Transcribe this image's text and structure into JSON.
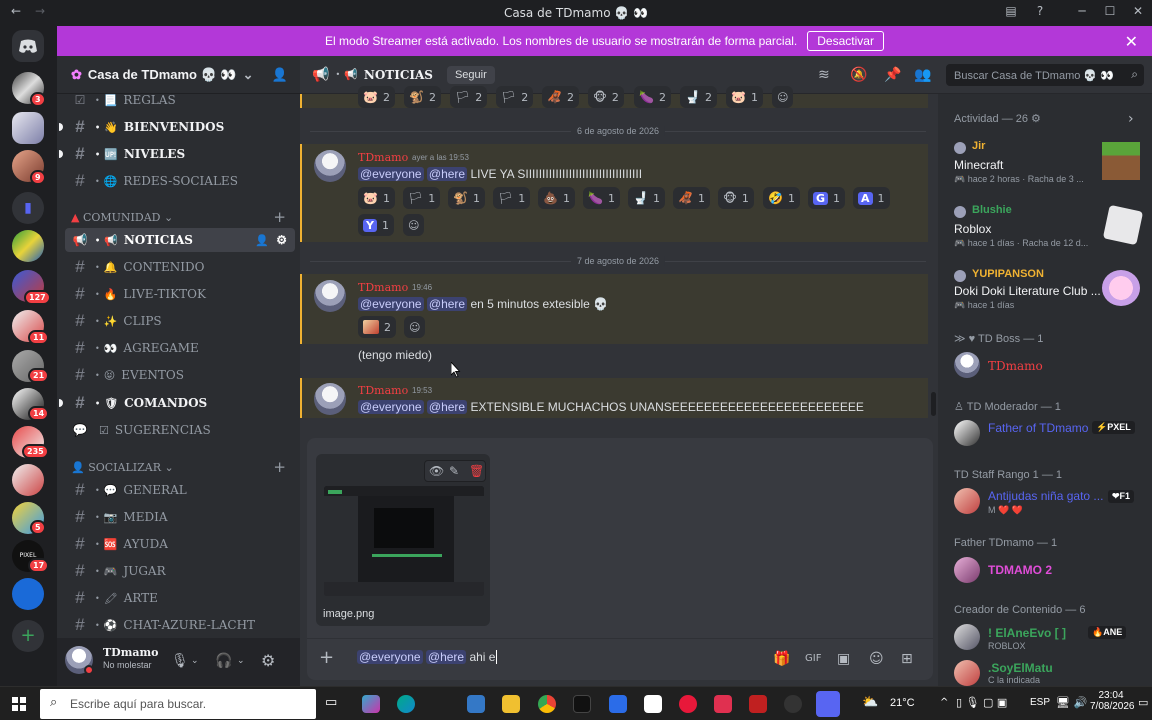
{
  "window": {
    "title": "Casa de TDmamo 💀 👀"
  },
  "banner": {
    "message": "El modo Streamer está activado. Los nombres de usuario se mostrarán de forma parcial.",
    "button": "Desactivar"
  },
  "server_badges": [
    "3",
    "9",
    "127",
    "11",
    "21",
    "14",
    "235",
    "5",
    "17"
  ],
  "server": {
    "name": "Casa de TDmamo 💀 👀"
  },
  "sidebar": {
    "channels_top": [
      {
        "emoji": "📃",
        "name": "REGLAS"
      },
      {
        "emoji": "👋",
        "name": "BIENVENIDOS"
      },
      {
        "emoji": "🆙",
        "name": "NIVELES"
      },
      {
        "emoji": "🌐",
        "name": "REDES-SOCIALES"
      }
    ],
    "cat_comunidad": "COMUNIDAD",
    "channels_comunidad": [
      {
        "emoji": "📢",
        "name": "NOTICIAS"
      },
      {
        "emoji": "🔔",
        "name": "CONTENIDO"
      },
      {
        "emoji": "🔥",
        "name": "LIVE-TIKTOK"
      },
      {
        "emoji": "✨",
        "name": "CLIPS"
      },
      {
        "emoji": "👀",
        "name": "AGREGAME"
      },
      {
        "emoji": "😝",
        "name": "EVENTOS"
      },
      {
        "emoji": "🛡",
        "name": "COMANDOS"
      },
      {
        "emoji": "☑",
        "name": "SUGERENCIAS"
      }
    ],
    "cat_socializar": "SOCIALIZAR",
    "channels_socializar": [
      {
        "emoji": "💬",
        "name": "GENERAL"
      },
      {
        "emoji": "📷",
        "name": "MEDIA"
      },
      {
        "emoji": "🆘",
        "name": "AYUDA"
      },
      {
        "emoji": "🎮",
        "name": "JUGAR"
      },
      {
        "emoji": "🖍",
        "name": "ARTE"
      },
      {
        "emoji": "⚽",
        "name": "CHAT-AZURE-LACHT"
      }
    ]
  },
  "user_panel": {
    "name": "TDmamo",
    "status": "No molestar"
  },
  "channel_header": {
    "name": "NOTICIAS",
    "follow": "Seguir",
    "search_placeholder": "Buscar Casa de TDmamo 💀 👀"
  },
  "chat": {
    "top_reactions": [
      "2",
      "2",
      "2",
      "2",
      "2",
      "2",
      "2",
      "2",
      "1"
    ],
    "date1": "6 de agosto de 2026",
    "msg1": {
      "author": "TDmamo",
      "time": "ayer a las 19:53",
      "mention1": "@everyone",
      "mention2": "@here",
      "text": "LIVE YA SIIIIIIIIIIIIIIIIIIIIIIIIIIIIIIIIIII",
      "reactions": [
        {
          "e": "🐷",
          "n": "1"
        },
        {
          "e": "🏳",
          "n": "1"
        },
        {
          "e": "🐒",
          "n": "1"
        },
        {
          "e": "🏳",
          "n": "1"
        },
        {
          "e": "💩",
          "n": "1"
        },
        {
          "e": "🍆",
          "n": "1"
        },
        {
          "e": "🚽",
          "n": "1"
        },
        {
          "e": "🦧",
          "n": "1"
        },
        {
          "e": "🐵",
          "n": "1"
        },
        {
          "e": "🤣",
          "n": "1"
        },
        {
          "e": "G",
          "n": "1"
        },
        {
          "e": "A",
          "n": "1"
        },
        {
          "e": "Y",
          "n": "1"
        }
      ]
    },
    "date2": "7 de agosto de 2026",
    "msg2": {
      "author": "TDmamo",
      "time": "19:46",
      "mention1": "@everyone",
      "mention2": "@here",
      "text": "en 5 minutos extesible 💀",
      "reaction_count": "2",
      "followup": "(tengo miedo)"
    },
    "msg3": {
      "author": "TDmamo",
      "time": "19:53",
      "mention1": "@everyone",
      "mention2": "@here",
      "text": "EXTENSIBLE MUCHACHOS UNANSEEEEEEEEEEEEEEEEEEEEEEEE"
    }
  },
  "composer": {
    "attachment_name": "image.png",
    "mention1": "@everyone",
    "mention2": "@here",
    "typed": "ahi e"
  },
  "members": {
    "activity_header": "Actividad — 26",
    "activities": [
      {
        "name": "Jir",
        "game": "Minecraft",
        "detail": "hace 2 horas · Racha de 3 ...",
        "color": "#f0b232"
      },
      {
        "name": "Blushie",
        "game": "Roblox",
        "detail": "hace 1 días · Racha de 12 d...",
        "color": "#3ba55c"
      },
      {
        "name": "YUPIPANSON",
        "game": "Doki Doki Literature Club ...",
        "detail": "hace 1 días",
        "color": "#f0b232"
      }
    ],
    "groups": [
      {
        "header": "TD Boss — 1",
        "name": "TDmamo",
        "sub": "",
        "color": "#f23f43"
      },
      {
        "header": "TD Moderador — 1",
        "name": "Father of TDmamo",
        "sub": "",
        "color": "#5865f2",
        "tag": "PXEL"
      },
      {
        "header": "TD Staff Rango 1 — 1",
        "name": "Antijudas niña gato ...",
        "sub": "M ❤️ ❤️",
        "color": "#5865f2",
        "tag": "F1"
      },
      {
        "header": "Father TDmamo — 1",
        "name": "TDMAMO 2",
        "sub": "",
        "color": "#e04dd8"
      },
      {
        "header": "Creador de Contenido — 6",
        "name": "! ElAneEvo [ ]",
        "sub": "ROBLOX",
        "color": "#3ba55c",
        "tag": "ANE"
      },
      {
        "header": "",
        "name": ".SoyElMatu",
        "sub": "C la indicada",
        "color": "#3ba55c"
      }
    ]
  },
  "taskbar": {
    "search_placeholder": "Escribe aquí para buscar.",
    "weather": "21°C",
    "lang": "ESP",
    "time": "23:04",
    "date": "7/08/2026"
  }
}
